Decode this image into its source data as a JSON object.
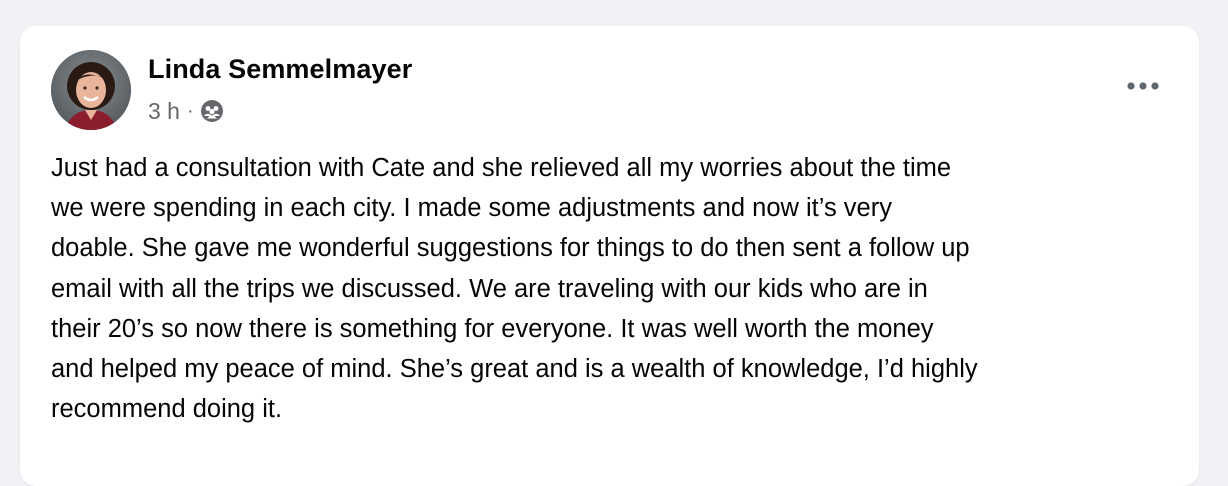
{
  "post": {
    "author_name": "Linda Semmelmayer",
    "timestamp": "3 h",
    "separator": "·",
    "audience_icon": "friends-icon",
    "more_icon": "more-options-icon",
    "text": "Just had a consultation with Cate and she relieved all my worries about the time\nwe were spending in each city. I made some adjustments and now it’s very\ndoable. She gave me wonderful suggestions for things to do then sent a follow up\nemail with all the trips we discussed. We are traveling with our kids who are in\ntheir 20’s so now there is something for everyone. It was well worth the money\nand helped my peace of mind. She’s great and is a wealth of knowledge, I’d highly\nrecommend doing it."
  },
  "colors": {
    "page_background": "#f0f2f5",
    "card_background": "#ffffff",
    "primary_text": "#050505",
    "secondary_text": "#65676b"
  }
}
